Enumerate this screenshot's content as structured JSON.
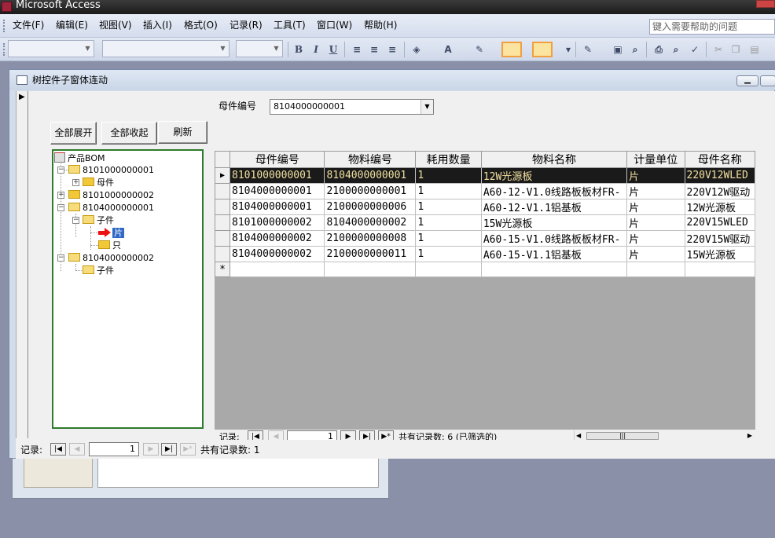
{
  "app": {
    "title": "Microsoft Access",
    "help_placeholder": "键入需要帮助的问题"
  },
  "menu": [
    {
      "label": "文件(F)"
    },
    {
      "label": "编辑(E)"
    },
    {
      "label": "视图(V)"
    },
    {
      "label": "插入(I)"
    },
    {
      "label": "格式(O)"
    },
    {
      "label": "记录(R)"
    },
    {
      "label": "工具(T)"
    },
    {
      "label": "窗口(W)"
    },
    {
      "label": "帮助(H)"
    }
  ],
  "toolbar_icons": [
    "bold-icon",
    "italic-icon",
    "underline-icon",
    "align-left-icon",
    "align-center-icon",
    "align-right-icon",
    "fill-color-icon",
    "font-color-icon",
    "line-color-icon",
    "border-color-icon",
    "line-style-icon",
    "special-effect-icon",
    "save-icon",
    "find-icon",
    "print-icon",
    "print-preview-icon",
    "spelling-icon",
    "cut-icon",
    "copy-icon",
    "paste-icon"
  ],
  "form": {
    "title": "树控件子窗体连动",
    "parent_label": "母件编号",
    "parent_value": "8104000000001",
    "buttons": {
      "expand_all": "全部展开",
      "collapse_all": "全部收起",
      "refresh": "刷新"
    }
  },
  "tree": {
    "root": "产品BOM",
    "nodes": [
      {
        "label": "8101000000001"
      },
      {
        "label": "母件"
      },
      {
        "label": "8101000000002"
      },
      {
        "label": "8104000000001"
      },
      {
        "label": "子件"
      },
      {
        "label": "片"
      },
      {
        "label": "只"
      },
      {
        "label": "8104000000002"
      },
      {
        "label": "子件"
      }
    ]
  },
  "grid": {
    "columns": [
      "母件编号",
      "物料编号",
      "耗用数量",
      "物料名称",
      "计量单位",
      "母件名称"
    ],
    "rows": [
      [
        "8101000000001",
        "8104000000001",
        "1",
        "12W光源板",
        "片",
        "220V12WLED"
      ],
      [
        "8104000000001",
        "2100000000001",
        "1",
        "A60-12-V1.0线路板板材FR-",
        "片",
        "220V12W驱动"
      ],
      [
        "8104000000001",
        "2100000000006",
        "1",
        "A60-12-V1.1铝基板",
        "片",
        "12W光源板"
      ],
      [
        "8101000000002",
        "8104000000002",
        "1",
        "15W光源板",
        "片",
        "220V15WLED"
      ],
      [
        "8104000000002",
        "2100000000008",
        "1",
        "A60-15-V1.0线路板板材FR-",
        "片",
        "220V15W驱动"
      ],
      [
        "8104000000002",
        "2100000000011",
        "1",
        "A60-15-V1.1铝基板",
        "片",
        "15W光源板"
      ]
    ],
    "new_row_marker": "*",
    "nav": {
      "label": "记录:",
      "current": "1",
      "total": "共有记录数: 6 (已筛选的)"
    }
  },
  "main_nav": {
    "label": "记录:",
    "current": "1",
    "total": "共有记录数: 1"
  }
}
